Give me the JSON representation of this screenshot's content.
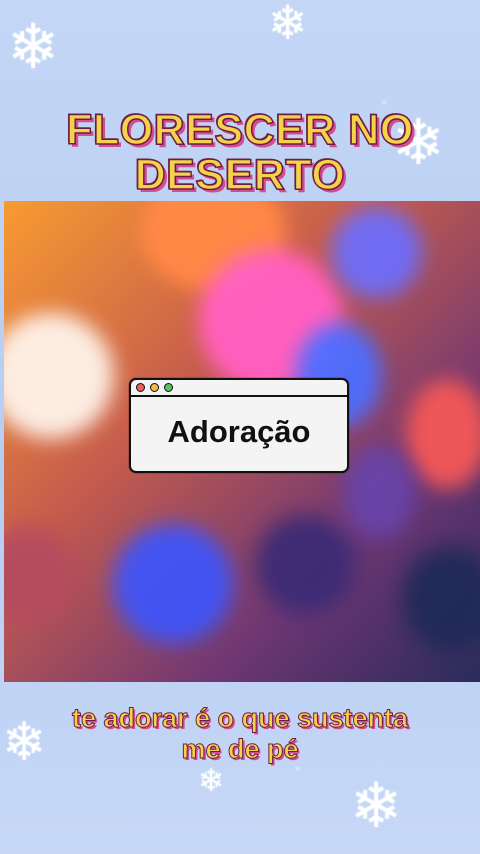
{
  "title": {
    "line1": "FLORESCER NO",
    "line2": "DESERTO"
  },
  "window": {
    "label": "Adoração",
    "controls": [
      "close-dot",
      "minimize-dot",
      "maximize-dot"
    ]
  },
  "caption": {
    "line1": "te adorar é o que sustenta",
    "line2": "me de pé"
  },
  "colors": {
    "background": "#BCD0F3",
    "title_fill": "#F4D34A",
    "title_stroke": "#6B1D46",
    "title_shadow": "#D84A91",
    "window_close": "#EF5A5A",
    "window_minimize": "#F3BD3A",
    "window_maximize": "#53C65B"
  },
  "icons": [
    "snowflake-icon",
    "window-dot-icon"
  ]
}
